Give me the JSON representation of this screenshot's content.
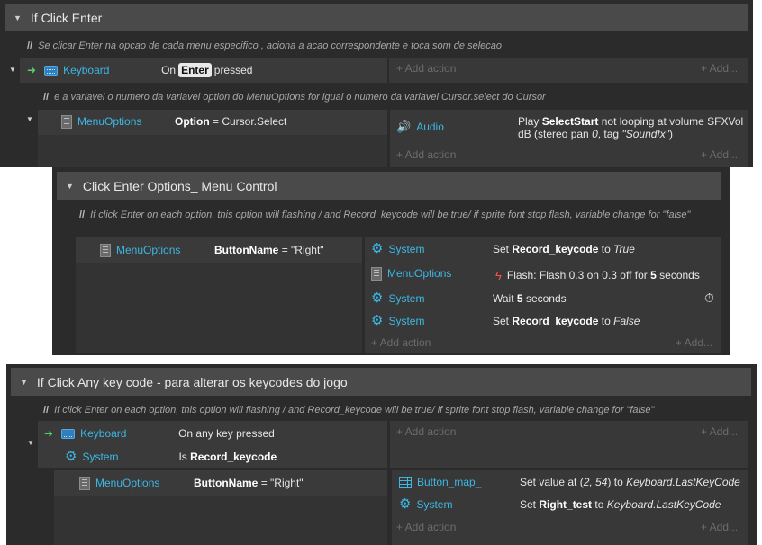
{
  "section1": {
    "title": "If Click Enter",
    "comment1": "Se clicar Enter na opcao de cada menu especifico , aciona a acao correspondente e toca som de selecao",
    "event1": {
      "object": "Keyboard",
      "cond_prefix": "On",
      "cond_key": "Enter",
      "cond_suffix": "pressed",
      "add_action": "+ Add action",
      "add_more": "+ Add..."
    },
    "comment2": "e a variavel o numero da variavel option do MenuOptions for igual o numero da variavel Cursor.select do Cursor",
    "event2": {
      "object": "MenuOptions",
      "cond_bold": "Option",
      "cond_rest": "= Cursor.Select",
      "action_object": "Audio",
      "action_text_1": "Play",
      "action_bold": "SelectStart",
      "action_text_2": "not looping at volume SFXVol",
      "action_text_3": "dB (stereo pan",
      "action_pan": "0",
      "action_text_4": ", tag",
      "action_tag": "\"Soundfx\"",
      "action_text_5": ")",
      "add_action": "+ Add action",
      "add_more": "+ Add..."
    }
  },
  "section2": {
    "title": "Click Enter Options_ Menu Control",
    "comment": "If click Enter on each option, this option will flashing / and Record_keycode will be true/  if sprite font stop flash, variable change for \"false\"",
    "event": {
      "object": "MenuOptions",
      "cond_bold": "ButtonName",
      "cond_rest": "= \"Right\"",
      "actions": [
        {
          "object": "System",
          "t1": "Set",
          "bold": "Record_keycode",
          "t2": "to",
          "it": "True"
        },
        {
          "object": "MenuOptions",
          "t1": "Flash: Flash 0.3 on 0.3 off for",
          "bold": "5",
          "t2": "seconds",
          "it": ""
        },
        {
          "object": "System",
          "t1": "Wait",
          "bold": "5",
          "t2": "seconds",
          "it": ""
        },
        {
          "object": "System",
          "t1": "Set",
          "bold": "Record_keycode",
          "t2": "to",
          "it": "False"
        }
      ],
      "add_action": "+ Add action",
      "add_more": "+ Add..."
    }
  },
  "section3": {
    "title": "If Click Any key code - para alterar os keycodes do jogo",
    "comment": "If click Enter on each option, this option will flashing / and Record_keycode will be true/  if sprite font stop flash, variable change for \"false\"",
    "event1": {
      "cond1_object": "Keyboard",
      "cond1_text": "On any key pressed",
      "cond2_object": "System",
      "cond2_prefix": "Is",
      "cond2_bold": "Record_keycode",
      "add_action": "+ Add action",
      "add_more": "+ Add..."
    },
    "event2": {
      "object": "MenuOptions",
      "cond_bold": "ButtonName",
      "cond_rest": "= \"Right\"",
      "action1_object": "Button_map_",
      "action1_t1": "Set value at (",
      "action1_it1": "2, 54",
      "action1_t2": ") to",
      "action1_it2": "Keyboard.LastKeyCode",
      "action2_object": "System",
      "action2_t1": "Set",
      "action2_bold": "Right_test",
      "action2_t2": "to",
      "action2_it": "Keyboard.LastKeyCode",
      "add_action": "+ Add action",
      "add_more": "+ Add..."
    }
  },
  "icons": {
    "keyboard": "keyboard-icon",
    "sprite_font": "sprite-font-icon",
    "system": "gear-icon",
    "audio": "speaker-icon",
    "flash": "lightning-icon",
    "array": "grid-icon",
    "wait": "timer-icon",
    "trigger": "green-arrow-icon"
  },
  "colors": {
    "object_name": "#3db7e4",
    "panel_bg": "#2b2b2b",
    "group_header": "#4a4a4a",
    "trigger_arrow": "#56d06c",
    "flash_icon": "#ff4f4f"
  }
}
